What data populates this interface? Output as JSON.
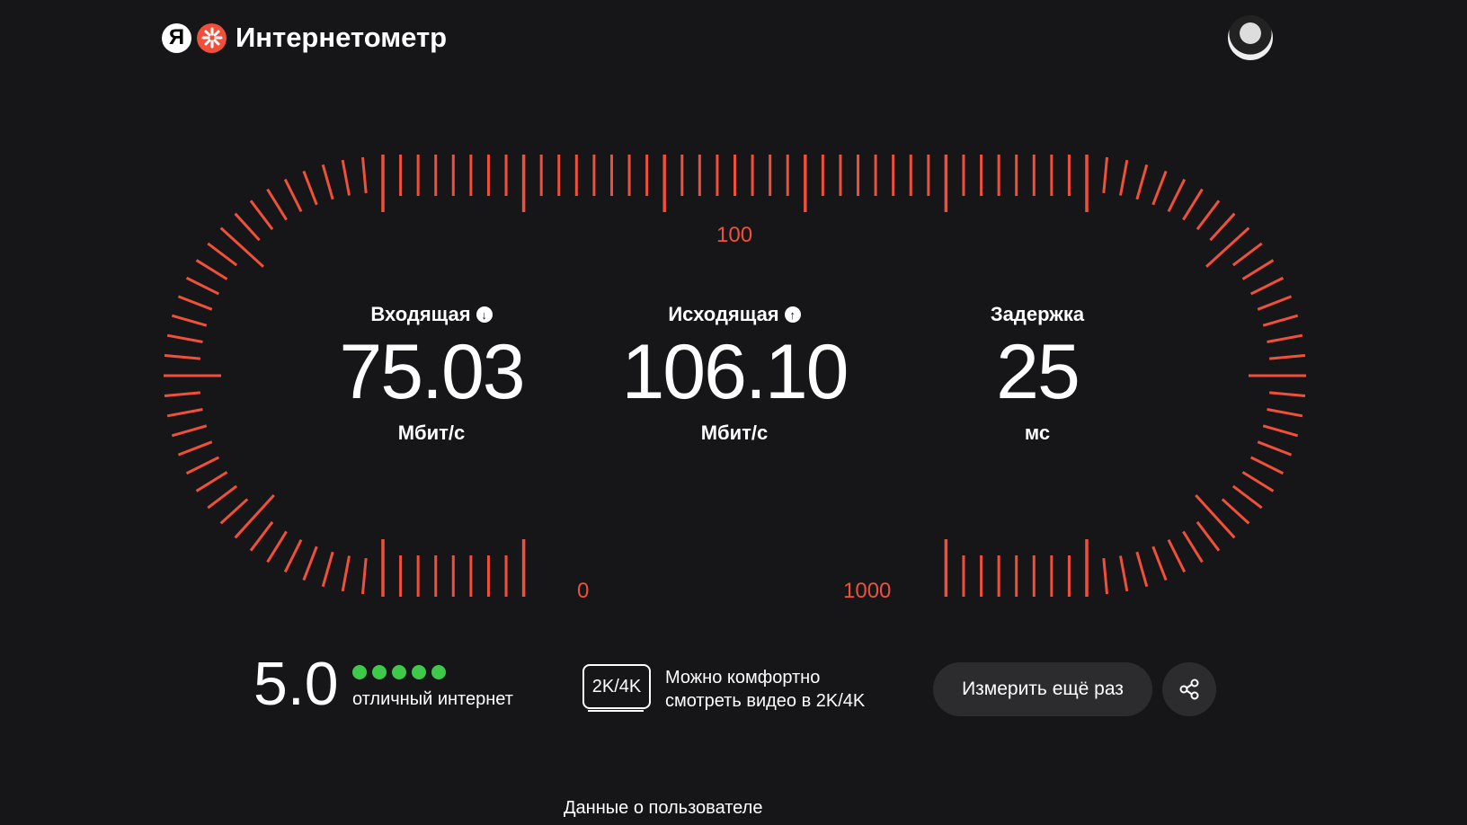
{
  "header": {
    "logo_letter": "Я",
    "brand": "Интернетометр"
  },
  "gauge": {
    "labels": {
      "top": "100",
      "bottom_left": "0",
      "bottom_right": "1000"
    },
    "color": "#f0503a"
  },
  "metrics": [
    {
      "title": "Входящая",
      "icon": "arrow-down-icon",
      "value": "75.03",
      "unit": "Мбит/с"
    },
    {
      "title": "Исходящая",
      "icon": "arrow-up-icon",
      "value": "106.10",
      "unit": "Мбит/с"
    },
    {
      "title": "Задержка",
      "value": "25",
      "unit": "мс"
    }
  ],
  "rating": {
    "score": "5.0",
    "dots_filled": 5,
    "dots_total": 5,
    "label": "отличный интернет"
  },
  "video": {
    "badge": "2K/4K",
    "text": "Можно комфортно смотреть видео в 2K/4K"
  },
  "actions": {
    "again": "Измерить ещё раз",
    "share_icon": "share-icon"
  },
  "footer": {
    "user_data": "Данные о пользователе"
  }
}
